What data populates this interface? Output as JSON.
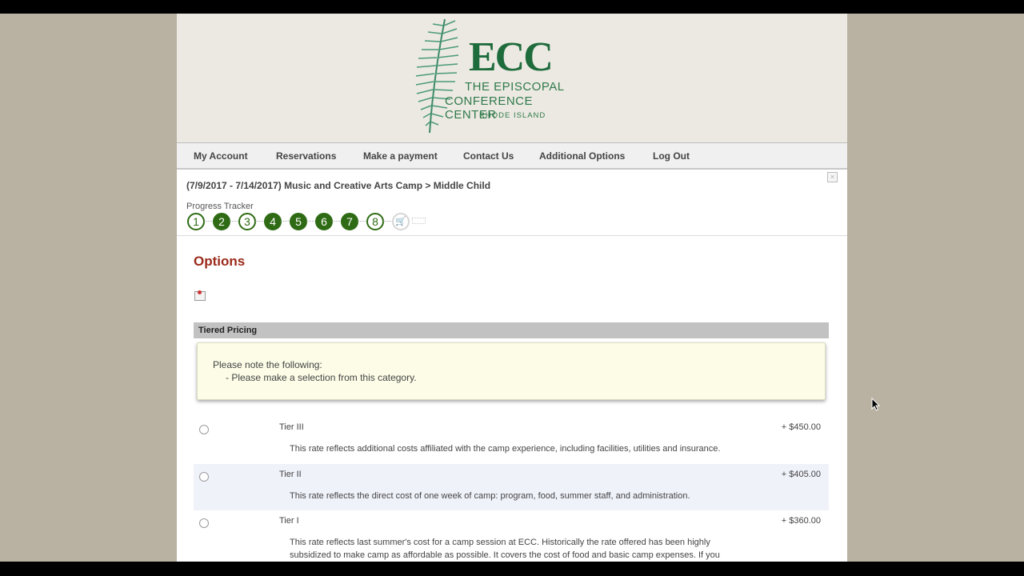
{
  "logo": {
    "ecc": "ECC",
    "line1": "THE EPISCOPAL",
    "line2": "CONFERENCE CENTER",
    "line3": "RHODE ISLAND"
  },
  "nav": {
    "items": [
      "My Account",
      "Reservations",
      "Make a payment",
      "Contact Us",
      "Additional Options",
      "Log Out"
    ]
  },
  "breadcrumb": "(7/9/2017 - 7/14/2017) Music and Creative Arts Camp > Middle Child",
  "progress": {
    "label": "Progress Tracker",
    "steps": [
      "1",
      "2",
      "3",
      "4",
      "5",
      "6",
      "7",
      "8"
    ],
    "completed": [
      false,
      true,
      false,
      true,
      true,
      true,
      true,
      false
    ]
  },
  "page_title": "Options",
  "section": {
    "title": "Tiered Pricing",
    "note_heading": "Please note the following:",
    "note_item": "- Please make a selection from this category."
  },
  "tiers": [
    {
      "name": "Tier III",
      "price": "+ $450.00",
      "description": "This rate reflects additional costs affiliated with the camp experience, including facilities, utilities and insurance."
    },
    {
      "name": "Tier II",
      "price": "+ $405.00",
      "description": "This rate reflects the direct cost of one week of camp: program, food, summer staff, and administration."
    },
    {
      "name": "Tier I",
      "price": "+ $360.00",
      "description": "This rate reflects last summer's cost for a camp session at ECC. Historically the rate offered has been highly subsidized to make camp as affordable as possible. It covers the cost of food and basic camp expenses. If you wish to apply for scholarship, choose this tier."
    }
  ],
  "colors": {
    "brand_green": "#1e6b3c",
    "tracker_green": "#2e6b14",
    "title_red": "#9a2a1a"
  }
}
